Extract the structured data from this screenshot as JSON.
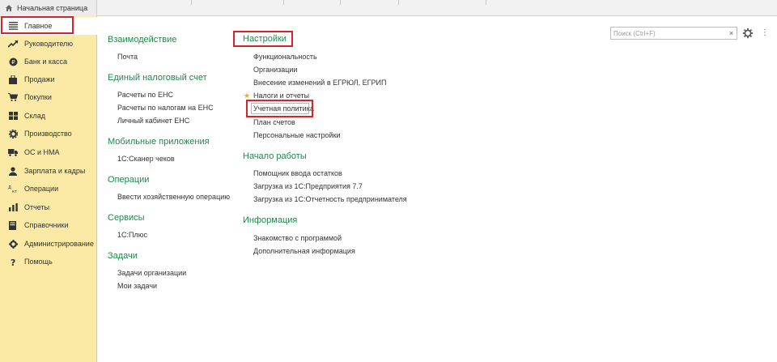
{
  "tabs": {
    "home_label": "Начальная страница"
  },
  "sidebar": {
    "items": [
      {
        "label": "Главное",
        "icon": "list-icon"
      },
      {
        "label": "Руководителю",
        "icon": "trend-icon"
      },
      {
        "label": "Банк и касса",
        "icon": "coin-icon"
      },
      {
        "label": "Продажи",
        "icon": "bag-icon"
      },
      {
        "label": "Покупки",
        "icon": "cart-icon"
      },
      {
        "label": "Склад",
        "icon": "warehouse-icon"
      },
      {
        "label": "Производство",
        "icon": "factory-icon"
      },
      {
        "label": "ОС и НМА",
        "icon": "truck-icon"
      },
      {
        "label": "Зарплата и кадры",
        "icon": "person-icon"
      },
      {
        "label": "Операции",
        "icon": "operations-icon"
      },
      {
        "label": "Отчеты",
        "icon": "bar-chart-icon"
      },
      {
        "label": "Справочники",
        "icon": "book-icon"
      },
      {
        "label": "Администрирование",
        "icon": "gear-icon"
      },
      {
        "label": "Помощь",
        "icon": "question-icon"
      }
    ]
  },
  "search": {
    "placeholder": "Поиск (Ctrl+F)",
    "clear_label": "×"
  },
  "colors": {
    "section_title": "#1d8a4a",
    "sidebar_bg": "#fbeaa6",
    "highlight": "#d8232a",
    "star": "#e8b000"
  },
  "left_column": [
    {
      "title": "Взаимодействие",
      "links": [
        "Почта"
      ]
    },
    {
      "title": "Единый налоговый счет",
      "links": [
        "Расчеты по ЕНС",
        "Расчеты по налогам на ЕНС",
        "Личный кабинет ЕНС"
      ]
    },
    {
      "title": "Мобильные приложения",
      "links": [
        "1С:Сканер чеков"
      ]
    },
    {
      "title": "Операции",
      "links": [
        "Ввести хозяйственную операцию"
      ]
    },
    {
      "title": "Сервисы",
      "links": [
        "1С:Плюс"
      ]
    },
    {
      "title": "Задачи",
      "links": [
        "Задачи организации",
        "Мои задачи"
      ]
    }
  ],
  "right_column": [
    {
      "title": "Настройки",
      "links": [
        "Функциональность",
        "Организации",
        "Внесение изменений в ЕГРЮЛ, ЕГРИП",
        "Налоги и отчеты",
        "Учетная политика",
        "План счетов",
        "Персональные настройки"
      ]
    },
    {
      "title": "Начало работы",
      "links": [
        "Помощник ввода остатков",
        "Загрузка из 1С:Предприятия 7.7",
        "Загрузка из 1С:Отчетность предпринимателя"
      ]
    },
    {
      "title": "Информация",
      "links": [
        "Знакомство с программой",
        "Дополнительная информация"
      ]
    }
  ]
}
